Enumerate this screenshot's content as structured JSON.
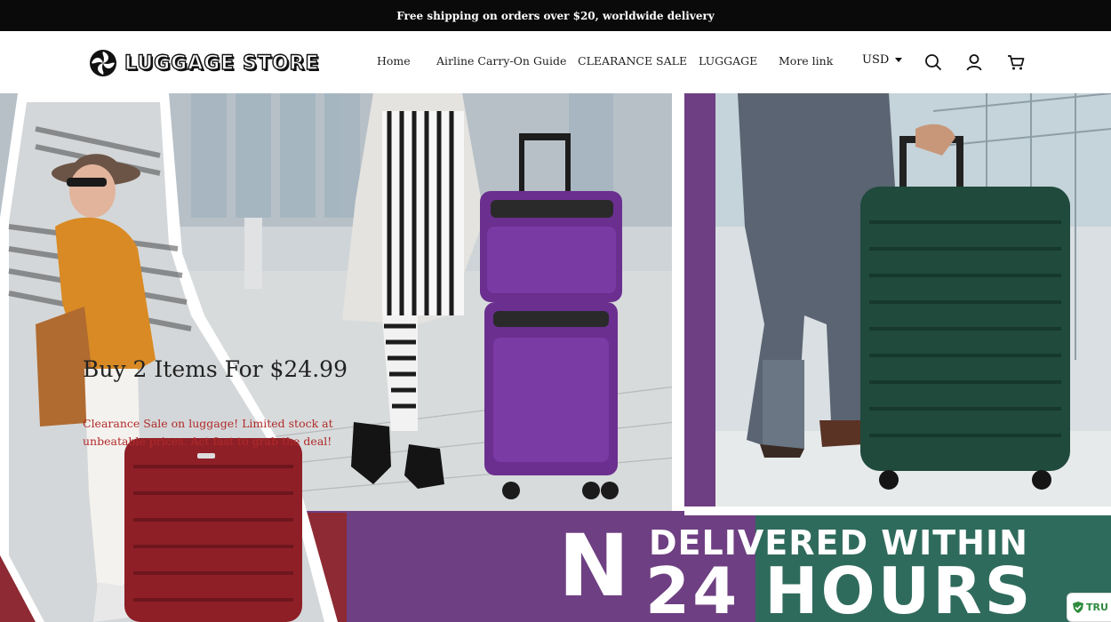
{
  "announcement": "Free shipping on orders over $20, worldwide delivery",
  "brand": {
    "name": "LUGGAGE STORE"
  },
  "nav": {
    "items": [
      {
        "label": "Home"
      },
      {
        "label": "Airline Carry-On Guide"
      },
      {
        "label": "CLEARANCE SALE"
      },
      {
        "label": "LUGGAGE"
      },
      {
        "label": "More link"
      }
    ]
  },
  "header": {
    "currency": "USD"
  },
  "hero": {
    "title": "Buy 2 Items For $24.99",
    "subtitle": "Clearance Sale on luggage! Limited stock at unbeatable prices. Act fast to grab the deal!",
    "banner_letter": "N",
    "banner_line1": "DELIVERED WITHIN",
    "banner_line2": "24 HOURS"
  },
  "trust_badge": {
    "label": "TRU"
  },
  "colors": {
    "announcement_bg": "#0a0a0a",
    "purple_panel": "#6e3f82",
    "teal_panel": "#2f6b5c",
    "red_panel": "#8e2a33",
    "subtitle_red": "#b02a2a"
  },
  "icons": [
    "brand-logo-icon",
    "search-icon",
    "account-icon",
    "cart-icon",
    "caret-down-icon",
    "shield-check-icon"
  ]
}
